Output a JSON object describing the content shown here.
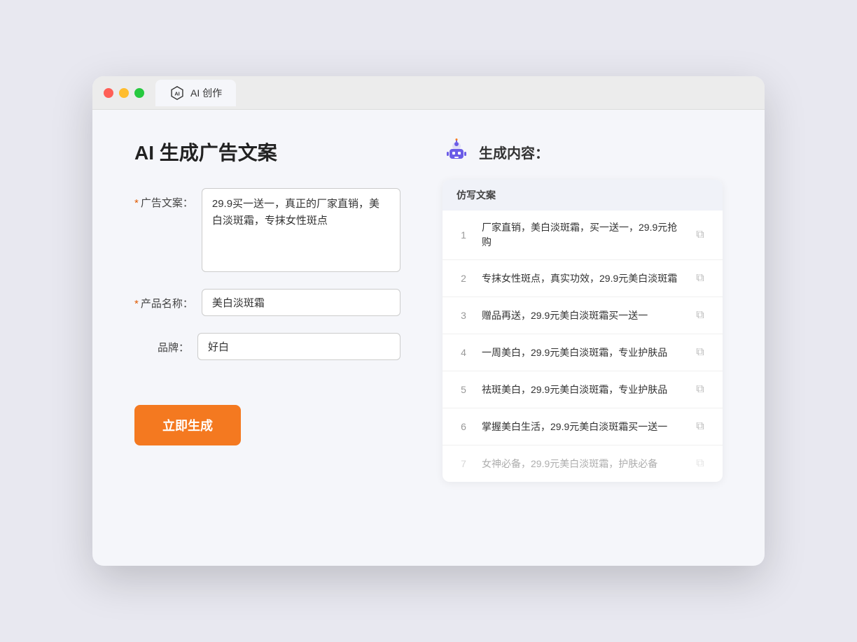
{
  "window": {
    "tab_label": "AI 创作"
  },
  "left_panel": {
    "title": "AI 生成广告文案",
    "form": {
      "ad_copy_label": "广告文案：",
      "ad_copy_value": "29.9买一送一，真正的厂家直销，美白淡斑霜，专抹女性斑点",
      "product_name_label": "产品名称：",
      "product_name_value": "美白淡斑霜",
      "brand_label": "品牌：",
      "brand_value": "好白"
    },
    "generate_button": "立即生成"
  },
  "right_panel": {
    "title": "生成内容：",
    "table_header": "仿写文案",
    "results": [
      {
        "id": 1,
        "text": "厂家直销，美白淡斑霜，买一送一，29.9元抢购"
      },
      {
        "id": 2,
        "text": "专抹女性斑点，真实功效，29.9元美白淡斑霜"
      },
      {
        "id": 3,
        "text": "赠品再送，29.9元美白淡斑霜买一送一"
      },
      {
        "id": 4,
        "text": "一周美白，29.9元美白淡斑霜，专业护肤品"
      },
      {
        "id": 5,
        "text": "祛斑美白，29.9元美白淡斑霜，专业护肤品"
      },
      {
        "id": 6,
        "text": "掌握美白生活，29.9元美白淡斑霜买一送一"
      },
      {
        "id": 7,
        "text": "女神必备，29.9元美白淡斑霜，护肤必备",
        "faded": true
      }
    ]
  }
}
